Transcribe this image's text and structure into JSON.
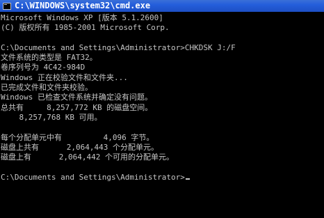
{
  "window": {
    "title": "C:\\WINDOWS\\system32\\cmd.exe",
    "icon": "console-icon"
  },
  "console": {
    "lines": [
      "Microsoft Windows XP [版本 5.1.2600]",
      "(C) 版权所有 1985-2001 Microsoft Corp.",
      "",
      "C:\\Documents and Settings\\Administrator>CHKDSK J:/F",
      "文件系统的类型是 FAT32。",
      "卷序列号为 4C42-984D",
      "Windows 正在校验文件和文件夹...",
      "已完成文件和文件夹校验。",
      "Windows 已检查文件系统并确定没有问题。",
      "总共有     8,257,772 KB 的磁盘空间。",
      "    8,257,768 KB 可用。",
      "",
      "每个分配单元中有         4,096 字节。",
      "磁盘上共有      2,064,443 个分配单元。",
      "磁盘上有      2,064,442 个可用的分配单元。",
      "",
      "C:\\Documents and Settings\\Administrator>"
    ]
  },
  "colors": {
    "background": "#000000",
    "text": "#c6c6c6",
    "titlebar": "#245edb"
  }
}
